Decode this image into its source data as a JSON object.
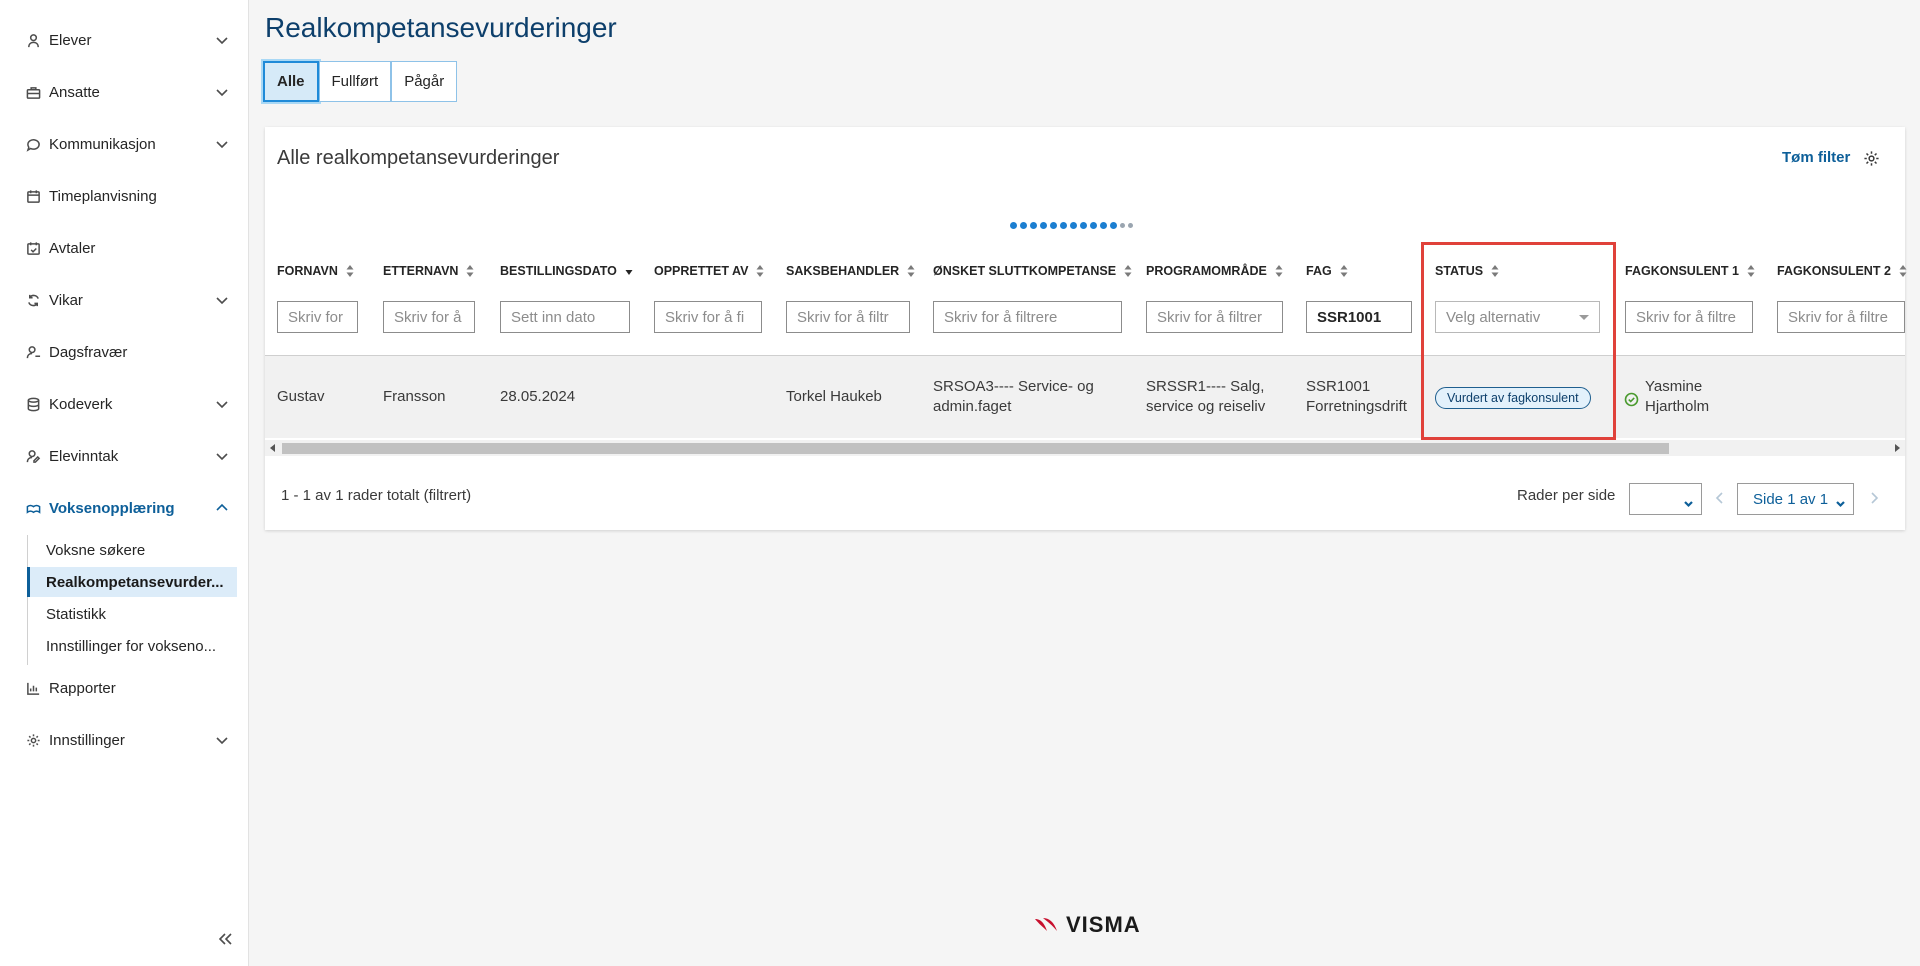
{
  "sidebar": {
    "items": [
      {
        "label": "Elever",
        "icon": "student-icon",
        "expandable": true
      },
      {
        "label": "Ansatte",
        "icon": "briefcase-icon",
        "expandable": true
      },
      {
        "label": "Kommunikasjon",
        "icon": "chat-icon",
        "expandable": true
      },
      {
        "label": "Timeplanvisning",
        "icon": "calendar-icon",
        "expandable": false
      },
      {
        "label": "Avtaler",
        "icon": "calendar-check-icon",
        "expandable": false
      },
      {
        "label": "Vikar",
        "icon": "refresh-icon",
        "expandable": true
      },
      {
        "label": "Dagsfravær",
        "icon": "user-absence-icon",
        "expandable": false
      },
      {
        "label": "Kodeverk",
        "icon": "database-icon",
        "expandable": true
      },
      {
        "label": "Elevinntak",
        "icon": "user-edit-icon",
        "expandable": true
      },
      {
        "label": "Voksenopplæring",
        "icon": "adult-education-icon",
        "expandable": true,
        "active": true
      },
      {
        "label": "Rapporter",
        "icon": "bar-chart-icon",
        "expandable": false
      },
      {
        "label": "Innstillinger",
        "icon": "gear-icon",
        "expandable": true
      }
    ],
    "subitems": [
      {
        "label": "Voksne søkere"
      },
      {
        "label": "Realkompetansevurder...",
        "selected": true
      },
      {
        "label": "Statistikk"
      },
      {
        "label": "Innstillinger for vokseno..."
      }
    ]
  },
  "page": {
    "title": "Realkompetansevurderinger",
    "segments": [
      {
        "label": "Alle",
        "selected": true
      },
      {
        "label": "Fullført"
      },
      {
        "label": "Pågår"
      }
    ]
  },
  "card": {
    "title": "Alle realkompetansevurderinger",
    "clear_filter": "Tøm filter",
    "columns": [
      {
        "header": "FORNAVN",
        "filter": "Skriv for"
      },
      {
        "header": "ETTERNAVN",
        "filter": "Skriv for å"
      },
      {
        "header": "BESTILLINGSDATO",
        "filter": "Sett inn dato",
        "sort": "desc"
      },
      {
        "header": "OPPRETTET AV",
        "filter": "Skriv for å fi"
      },
      {
        "header": "SAKSBEHANDLER",
        "filter": "Skriv for å filtr"
      },
      {
        "header": "ØNSKET SLUTTKOMPETANSE",
        "filter": "Skriv for å filtrere"
      },
      {
        "header": "PROGRAMOMRÅDE",
        "filter": "Skriv for å filtrer"
      },
      {
        "header": "FAG",
        "filter": "SSR1001"
      },
      {
        "header": "STATUS",
        "filter": "Velg alternativ"
      },
      {
        "header": "FAGKONSULENT 1",
        "filter": "Skriv for å filtre"
      },
      {
        "header": "FAGKONSULENT 2",
        "filter": "Skriv for å filtre"
      }
    ],
    "row": {
      "fornavn": "Gustav",
      "etternavn": "Fransson",
      "bestillingsdato": "28.05.2024",
      "opprettet_av": "",
      "saksbehandler": "Torkel Haukeb",
      "sluttkompetanse_1": "SRSOA3---- Service- og",
      "sluttkompetanse_2": "admin.faget",
      "programomrade_1": "SRSSR1---- Salg,",
      "programomrade_2": "service og reiseliv",
      "fag_1": "SSR1001",
      "fag_2": "Forretningsdrift",
      "status": "Vurdert av fagkonsulent",
      "fagkonsulent1_1": "Yasmine",
      "fagkonsulent1_2": "Hjartholm"
    },
    "footer": {
      "rows_total": "1 - 1 av 1 rader totalt (filtrert)",
      "rows_per_page_label": "Rader per side",
      "rows_per_page_value": "",
      "page_select": "Side 1 av 1"
    }
  },
  "brand": {
    "logo_text": "VISMA",
    "accent": "#0d5f99",
    "highlight": "#e0413a"
  }
}
